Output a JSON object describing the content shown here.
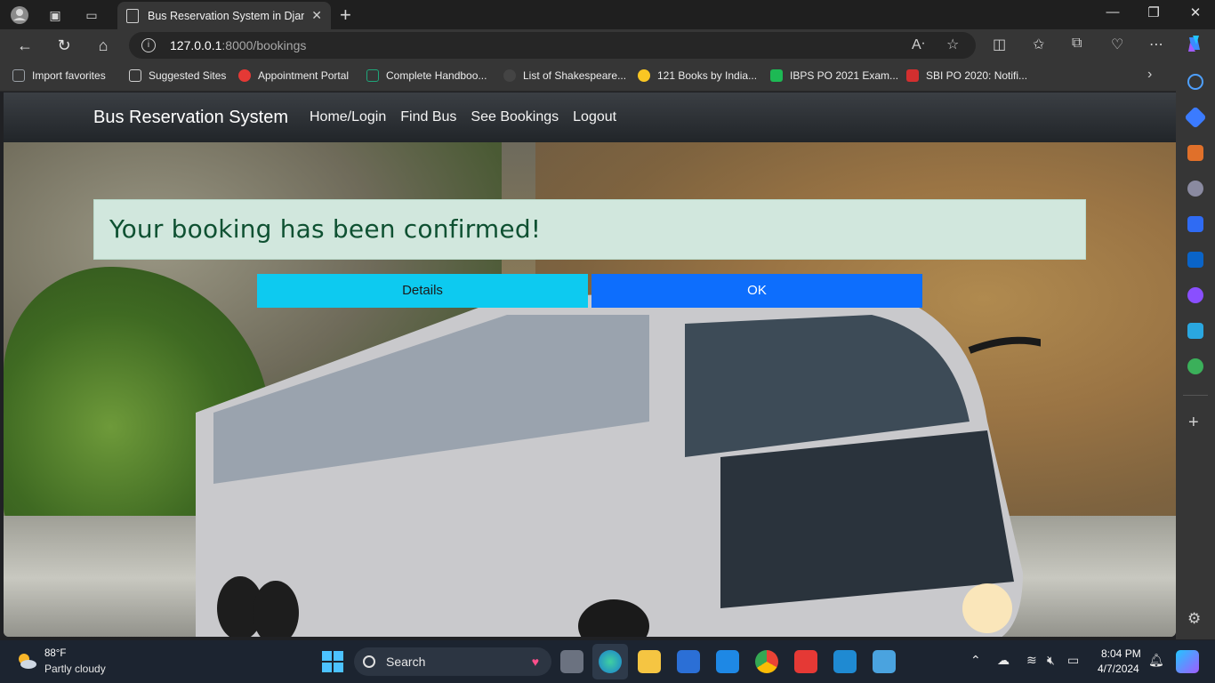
{
  "browser": {
    "tab_title": "Bus Reservation System in Djang",
    "tab_close": "✕",
    "new_tab": "+",
    "url_host": "127.0.0.1",
    "url_path": ":8000/bookings",
    "window_minimize": "—",
    "window_restore": "❐",
    "window_close": "✕"
  },
  "favorites": [
    {
      "label": "Import favorites",
      "color": "#9aa0a6"
    },
    {
      "label": "Suggested Sites",
      "color": "#d0d0d0"
    },
    {
      "label": "Appointment Portal",
      "color": "#e53935"
    },
    {
      "label": "Complete Handboo...",
      "color": "#1fa67a"
    },
    {
      "label": "List of Shakespeare...",
      "color": "#444444"
    },
    {
      "label": "121 Books by India...",
      "color": "#f9c623"
    },
    {
      "label": "IBPS PO 2021 Exam...",
      "color": "#1db954"
    },
    {
      "label": "SBI PO 2020: Notifi...",
      "color": "#d32f2f"
    }
  ],
  "site": {
    "brand": "Bus Reservation System",
    "nav": [
      "Home/Login",
      "Find Bus",
      "See Bookings",
      "Logout"
    ],
    "alert_message": "Your booking has been confirmed!",
    "details_button": "Details",
    "ok_button": "OK"
  },
  "taskbar": {
    "temperature": "88°F",
    "weather": "Partly cloudy",
    "search_placeholder": "Search",
    "time": "8:04 PM",
    "date": "4/7/2024"
  }
}
